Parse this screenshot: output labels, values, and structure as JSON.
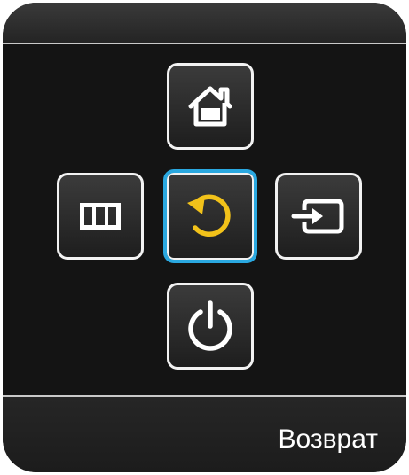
{
  "controls": {
    "up": {
      "icon": "home-icon",
      "selected": false
    },
    "left": {
      "icon": "menu-icon",
      "selected": false
    },
    "center": {
      "icon": "return-icon",
      "selected": true
    },
    "right": {
      "icon": "source-icon",
      "selected": false
    },
    "down": {
      "icon": "power-icon",
      "selected": false
    }
  },
  "status": {
    "label": "Возврат"
  },
  "colors": {
    "panel_background": "#141414",
    "button_border": "#f2f2f2",
    "selection_highlight": "#2aa8e0",
    "return_icon": "#f2c21a",
    "icon_default": "#ffffff",
    "label_text": "#ffffff"
  }
}
